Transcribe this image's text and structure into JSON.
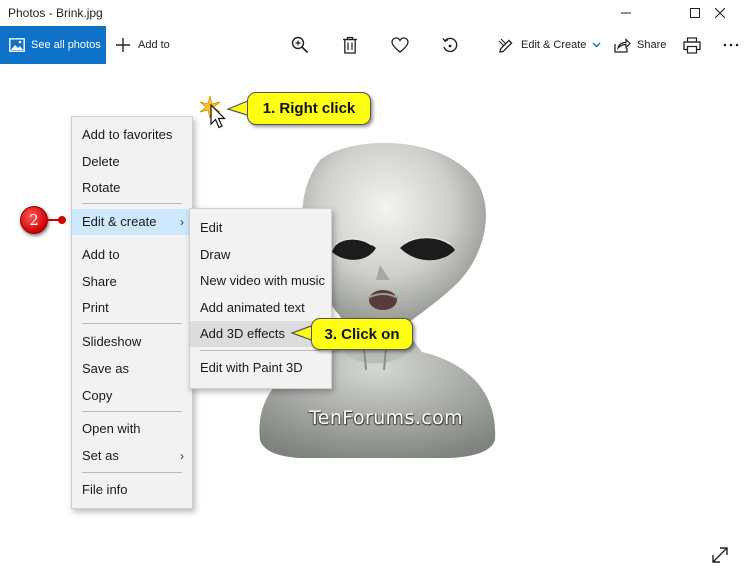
{
  "window": {
    "title": "Photos - Brink.jpg"
  },
  "toolbar": {
    "see_all": "See all photos",
    "add_to": "Add to",
    "edit_create": "Edit & Create",
    "share": "Share"
  },
  "context_menu": {
    "items": [
      "Add to favorites",
      "Delete",
      "Rotate",
      "Edit & create",
      "Add to",
      "Share",
      "Print",
      "Slideshow",
      "Save as",
      "Copy",
      "Open with",
      "Set as",
      "File info"
    ]
  },
  "submenu": {
    "items": [
      "Edit",
      "Draw",
      "New video with music",
      "Add animated text",
      "Add 3D effects",
      "Edit with Paint 3D"
    ]
  },
  "annotations": {
    "step1": "1. Right click",
    "step2": "2",
    "step3": "3. Click on"
  },
  "watermark": "TenForums.com",
  "colors": {
    "accent": "#0f72c9",
    "menu_highlight": "#cde8ff",
    "callout": "#ffff14",
    "step_badge": "#d00000"
  }
}
